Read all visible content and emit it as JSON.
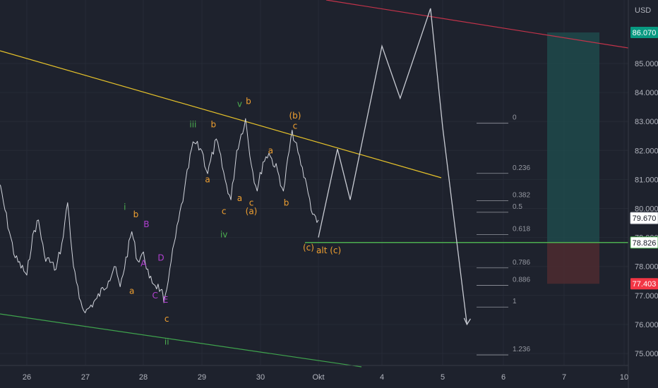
{
  "currency": "USD",
  "colors": {
    "background": "#1e222d",
    "price_line": "#d1d4dc",
    "upper_trendline": "#e6c22a",
    "lower_trendline": "#3fa34d",
    "resistance_line": "#c2334a",
    "support_line": "#4caf50",
    "profit_zone": "#1f4f4f",
    "loss_zone": "#4a2a30",
    "take_profit_badge": "#089981",
    "stop_loss_badge": "#f23645",
    "current_badge": "#ffffff",
    "wave_orange": "#f0a030",
    "wave_green": "#4caf50",
    "wave_purple": "#b040d0"
  },
  "price_badges": [
    {
      "id": "take-profit",
      "label": "86.070",
      "value": 86.07
    },
    {
      "id": "current-price",
      "label": "79.670",
      "value": 79.67
    },
    {
      "id": "entry",
      "label": "78.826",
      "value": 78.826
    },
    {
      "id": "stop-loss",
      "label": "77.403",
      "value": 77.403
    }
  ],
  "alt_label": "alt (c)",
  "fib_levels": [
    {
      "label": "0",
      "value": 82.94
    },
    {
      "label": "0.236",
      "value": 81.21
    },
    {
      "label": "0.382",
      "value": 80.27
    },
    {
      "label": "0.5",
      "value": 79.87
    },
    {
      "label": "0.618",
      "value": 79.1
    },
    {
      "label": "0.786",
      "value": 77.95
    },
    {
      "label": "0.886",
      "value": 77.35
    },
    {
      "label": "1",
      "value": 76.6
    },
    {
      "label": "1.236",
      "value": 74.95
    }
  ],
  "chart_data": {
    "type": "line",
    "title": "",
    "ylabel": "USD",
    "ylim": [
      74.6,
      89.5
    ],
    "y_ticks": [
      "75.000",
      "76.000",
      "77.000",
      "78.000",
      "79.000",
      "80.000",
      "81.000",
      "82.000",
      "83.000",
      "84.000",
      "85.000"
    ],
    "x_ticks": [
      "26",
      "27",
      "28",
      "29",
      "30",
      "Okt",
      "4",
      "5",
      "6",
      "7",
      "10"
    ],
    "series": [
      {
        "values": [
          {
            "x": "25.5",
            "y": 81.1
          },
          {
            "x": "25.6",
            "y": 80.2
          },
          {
            "x": "25.7",
            "y": 79.2
          },
          {
            "x": "25.8",
            "y": 78.3
          },
          {
            "x": "26.0",
            "y": 77.7
          },
          {
            "x": "26.1",
            "y": 79.1
          },
          {
            "x": "26.2",
            "y": 79.6
          },
          {
            "x": "26.3",
            "y": 78.4
          },
          {
            "x": "26.5",
            "y": 77.9
          },
          {
            "x": "26.6",
            "y": 78.8
          },
          {
            "x": "26.7",
            "y": 80.2
          },
          {
            "x": "26.8",
            "y": 78.0
          },
          {
            "x": "26.9",
            "y": 76.9
          },
          {
            "x": "27.0",
            "y": 76.4
          },
          {
            "x": "27.2",
            "y": 76.9
          },
          {
            "x": "27.4",
            "y": 77.5
          },
          {
            "x": "27.5",
            "y": 78.0
          },
          {
            "x": "27.6",
            "y": 77.3
          },
          {
            "x": "27.8",
            "y": 79.2
          },
          {
            "x": "27.9",
            "y": 78.2
          },
          {
            "x": "28.0",
            "y": 78.5
          },
          {
            "x": "28.1",
            "y": 77.6
          },
          {
            "x": "28.3",
            "y": 77.2
          },
          {
            "x": "28.35",
            "y": 76.75
          },
          {
            "x": "28.45",
            "y": 77.9
          },
          {
            "x": "28.55",
            "y": 79.0
          },
          {
            "x": "28.7",
            "y": 80.6
          },
          {
            "x": "28.85",
            "y": 82.3
          },
          {
            "x": "29.0",
            "y": 82.0
          },
          {
            "x": "29.1",
            "y": 81.2
          },
          {
            "x": "29.25",
            "y": 82.4
          },
          {
            "x": "29.4",
            "y": 81.0
          },
          {
            "x": "29.5",
            "y": 80.3
          },
          {
            "x": "29.6",
            "y": 82.0
          },
          {
            "x": "29.75",
            "y": 83.1
          },
          {
            "x": "29.85",
            "y": 81.5
          },
          {
            "x": "29.95",
            "y": 80.6
          },
          {
            "x": "30.05",
            "y": 81.6
          },
          {
            "x": "30.15",
            "y": 81.9
          },
          {
            "x": "30.3",
            "y": 81.3
          },
          {
            "x": "30.4",
            "y": 80.6
          },
          {
            "x": "30.55",
            "y": 82.7
          },
          {
            "x": "30.7",
            "y": 81.5
          },
          {
            "x": "30.8",
            "y": 80.8
          },
          {
            "x": "30.9",
            "y": 79.8
          },
          {
            "x": "31.0",
            "y": 79.6
          }
        ]
      },
      {
        "name": "",
        "values": [
          {
            "x": "Okt",
            "y": 79.0
          },
          {
            "x": "3.3",
            "y": 82.05
          },
          {
            "x": "3.5",
            "y": 80.3
          },
          {
            "x": "4.0",
            "y": 85.6
          },
          {
            "x": "4.3",
            "y": 83.8
          },
          {
            "x": "4.8",
            "y": 86.9
          },
          {
            "x": "5.0",
            "y": 82.8
          },
          {
            "x": "5.4",
            "y": 76.0
          }
        ]
      }
    ]
  },
  "wave_labels": [
    {
      "text": "i",
      "color": "green",
      "day": 1.68,
      "price": 79.95
    },
    {
      "text": "b",
      "color": "orange",
      "day": 1.87,
      "price": 79.7
    },
    {
      "text": "B",
      "color": "purple",
      "day": 2.05,
      "price": 79.35
    },
    {
      "text": "A",
      "color": "purple",
      "day": 2.0,
      "price": 78.0
    },
    {
      "text": "D",
      "color": "purple",
      "day": 2.3,
      "price": 78.2
    },
    {
      "text": "a",
      "color": "orange",
      "day": 1.8,
      "price": 77.05
    },
    {
      "text": "C",
      "color": "purple",
      "day": 2.2,
      "price": 76.9
    },
    {
      "text": "E",
      "color": "purple",
      "day": 2.38,
      "price": 76.75
    },
    {
      "text": "c",
      "color": "orange",
      "day": 2.4,
      "price": 76.1
    },
    {
      "text": "ii",
      "color": "green",
      "day": 2.4,
      "price": 75.3
    },
    {
      "text": "iii",
      "color": "green",
      "day": 2.85,
      "price": 82.8
    },
    {
      "text": "b",
      "color": "orange",
      "day": 3.2,
      "price": 82.8
    },
    {
      "text": "a",
      "color": "orange",
      "day": 3.1,
      "price": 80.9
    },
    {
      "text": "v",
      "color": "green",
      "day": 3.65,
      "price": 83.5
    },
    {
      "text": "b",
      "color": "orange",
      "day": 3.8,
      "price": 83.6
    },
    {
      "text": "a",
      "color": "orange",
      "day": 4.18,
      "price": 81.9
    },
    {
      "text": "a",
      "color": "orange",
      "day": 3.65,
      "price": 80.25
    },
    {
      "text": "c",
      "color": "orange",
      "day": 3.85,
      "price": 80.1
    },
    {
      "text": "c",
      "color": "orange",
      "day": 3.38,
      "price": 79.8
    },
    {
      "text": "(a)",
      "color": "orange",
      "day": 3.85,
      "price": 79.8
    },
    {
      "text": "iv",
      "color": "green",
      "day": 3.38,
      "price": 79.0
    },
    {
      "text": "(b)",
      "color": "orange",
      "day": 4.6,
      "price": 83.1
    },
    {
      "text": "c",
      "color": "orange",
      "day": 4.6,
      "price": 82.75
    },
    {
      "text": "b",
      "color": "orange",
      "day": 4.45,
      "price": 80.1
    },
    {
      "text": "(c)",
      "color": "orange",
      "day": 4.83,
      "price": 78.55
    }
  ]
}
